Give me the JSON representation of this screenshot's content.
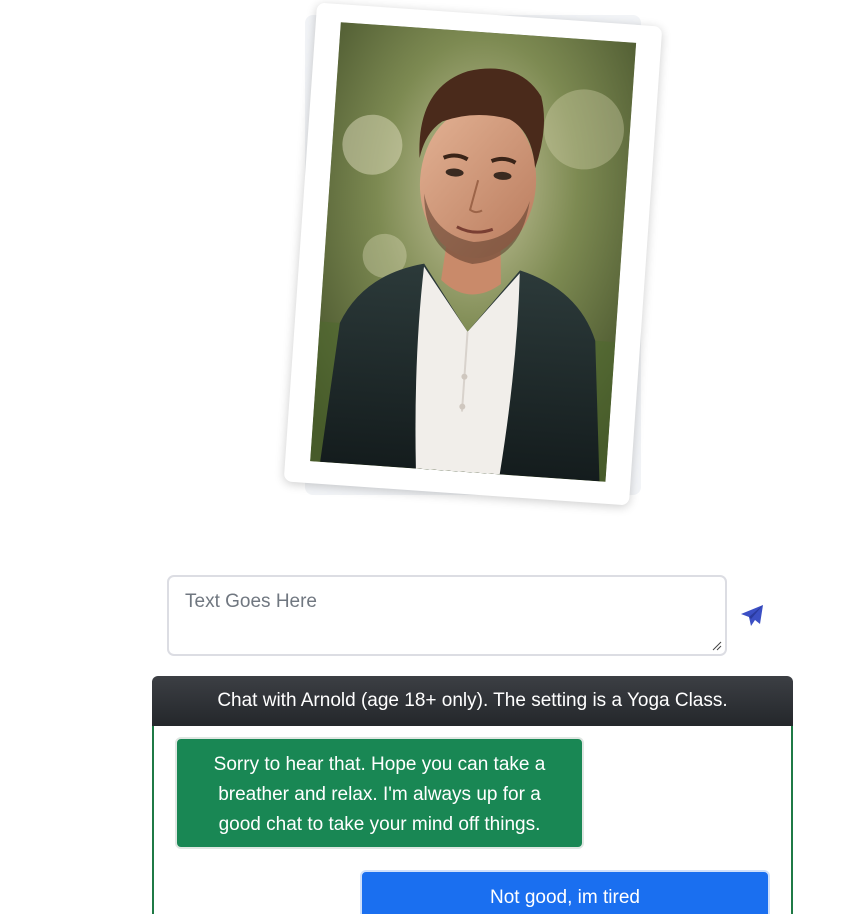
{
  "profile": {
    "photo_alt": "",
    "frame_color": "#ffffff"
  },
  "composer": {
    "placeholder": "Text Goes Here",
    "value": "",
    "send_icon": "paper-plane-icon",
    "send_icon_color": "#3b4fc4"
  },
  "chat": {
    "header": "Chat with Arnold (age 18+ only). The setting is a Yoga Class.",
    "messages": [
      {
        "sender": "ai",
        "text": "Sorry to hear that. Hope you can take a breather and relax. I'm always up for a good chat to take your mind off things.",
        "color": "#198754"
      },
      {
        "sender": "user",
        "text": "Not good, im tired",
        "color": "#1a6ff0"
      }
    ]
  }
}
